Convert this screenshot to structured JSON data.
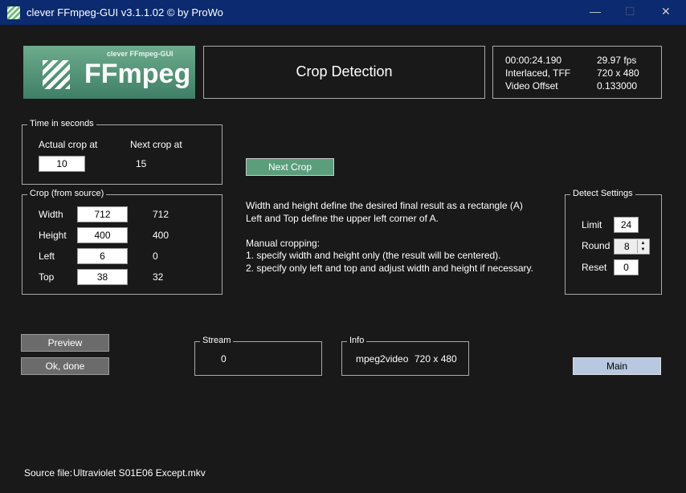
{
  "window": {
    "title": "clever FFmpeg-GUI v3.1.1.02   © by ProWo",
    "min": "—",
    "max": "☐",
    "close": "✕"
  },
  "logo": {
    "subtitle": "clever FFmpeg-GUI",
    "name": "FFmpeg"
  },
  "header": {
    "title": "Crop Detection"
  },
  "video_info": {
    "time": "00:00:24.190",
    "fps": "29.97 fps",
    "scan": "Interlaced, TFF",
    "resolution": "720 x 480",
    "offset_label": "Video Offset",
    "offset": "0.133000"
  },
  "time_group": {
    "legend": "Time in seconds",
    "actual_label": "Actual crop at",
    "next_label": "Next crop at",
    "actual_value": "10",
    "next_value": "15"
  },
  "next_crop_button": "Next Crop",
  "crop_group": {
    "legend": "Crop (from source)",
    "rows": [
      {
        "label": "Width",
        "value": "712",
        "source": "712"
      },
      {
        "label": "Height",
        "value": "400",
        "source": "400"
      },
      {
        "label": "Left",
        "value": "6",
        "source": "0"
      },
      {
        "label": "Top",
        "value": "38",
        "source": "32"
      }
    ]
  },
  "help": [
    "Width and height define the desired final result as a rectangle (A)",
    "Left and Top define the upper left corner of A.",
    "",
    "Manual cropping:",
    "1. specify width and height only (the result will be centered).",
    "2. specify only left and top and adjust width and height if necessary."
  ],
  "detect": {
    "legend": "Detect Settings",
    "limit_label": "Limit",
    "limit": "24",
    "round_label": "Round",
    "round": "8",
    "reset_label": "Reset",
    "reset": "0"
  },
  "buttons": {
    "preview": "Preview",
    "ok": "Ok, done",
    "main": "Main"
  },
  "stream": {
    "legend": "Stream",
    "value": "0"
  },
  "info": {
    "legend": "Info",
    "codec": "mpeg2video",
    "resolution": "720 x 480"
  },
  "source": {
    "label": "Source file:",
    "file": "Ultraviolet S01E06 Except.mkv"
  },
  "colors": {
    "titlebar": "#0b2a6f",
    "accent_green": "#5a9e7c",
    "main_button": "#b8c8e0"
  }
}
